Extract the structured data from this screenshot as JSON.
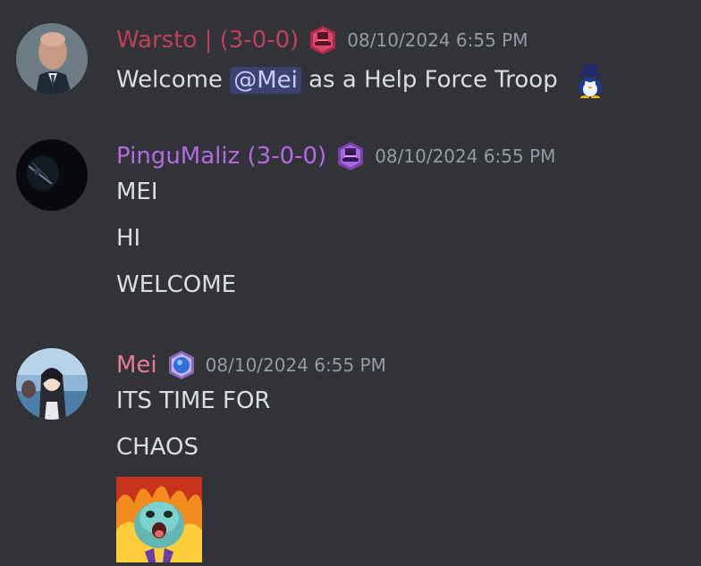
{
  "messages": [
    {
      "username": "Warsto | (3-0-0)",
      "username_color": "#c0405c",
      "role_icon": "red-tophat-badge-icon",
      "timestamp": "08/10/2024 6:55 PM",
      "avatar": "bald-man-avatar",
      "content": {
        "prefix": "Welcome",
        "mention": "@Mei",
        "suffix": "as a Help Force Troop",
        "emoji": "penguin-tophat-emoji-icon"
      }
    },
    {
      "username": "PinguMaliz (3-0-0)",
      "username_color": "#b56ae0",
      "role_icon": "purple-tophat-badge-icon",
      "timestamp": "08/10/2024 6:55 PM",
      "avatar": "dark-figure-avatar",
      "lines": [
        "MEI",
        "HI",
        "WELCOME"
      ]
    },
    {
      "username": "Mei",
      "username_color": "#e87a9a",
      "role_icon": "blue-orb-badge-icon",
      "timestamp": "08/10/2024 6:55 PM",
      "avatar": "anime-girl-avatar",
      "lines": [
        "ITS TIME FOR",
        "CHAOS"
      ],
      "attachment": "screaming-creature-fire-gif"
    }
  ]
}
